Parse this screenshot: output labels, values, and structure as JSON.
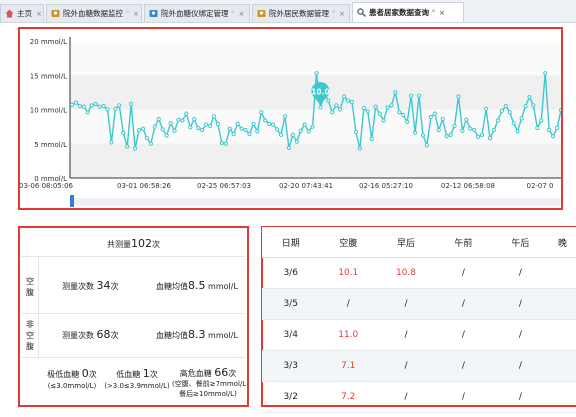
{
  "tabs": [
    {
      "label": "主页",
      "icon": "home-icon",
      "closable": true,
      "refresh": false
    },
    {
      "label": "院外血糖数据监控",
      "icon": "user-edit-icon",
      "closable": true,
      "refresh": true
    },
    {
      "label": "院外血糖仪绑定管理",
      "icon": "monitor-icon",
      "closable": true,
      "refresh": true
    },
    {
      "label": "院外居民数据管理",
      "icon": "user-edit-icon",
      "closable": true,
      "refresh": true
    },
    {
      "label": "患者居家数据查询",
      "icon": "search-icon",
      "closable": true,
      "refresh": true,
      "active": true
    }
  ],
  "tab_refresh_glyph": "ᴳ",
  "tab_close_glyph": "×",
  "chart_data": {
    "type": "line",
    "yticks": [
      "20 mmol/L",
      "15 mmol/L",
      "10 mmol/L",
      "5 mmol/L",
      "0 mmol/L"
    ],
    "ylim": [
      0,
      20
    ],
    "xticks": [
      "03-06 08:05:06",
      "03-01 06:58:26",
      "02-25 06:57:03",
      "02-20 07:43:41",
      "02-16 05:27:10",
      "02-12 06:58:08",
      "02-07 0"
    ],
    "tooltip": "10.0",
    "color": "#3cc8cf",
    "series": [
      {
        "values": [
          10.7,
          11.0,
          10.5,
          10.4,
          9.6,
          10.6,
          10.8,
          10.4,
          10.5,
          10.0,
          5.2,
          10.1,
          10.6,
          6.6,
          4.6,
          10.8,
          4.3,
          7.0,
          7.2,
          5.8,
          5.0,
          7.5,
          8.6,
          7.1,
          6.2,
          8.0,
          6.9,
          8.5,
          8.4,
          9.4,
          7.4,
          8.6,
          7.3,
          7.0,
          7.8,
          7.6,
          9.0,
          7.9,
          5.1,
          5.0,
          7.2,
          6.4,
          7.9,
          7.2,
          7.0,
          6.4,
          7.9,
          6.8,
          9.6,
          8.4,
          7.9,
          7.8,
          7.1,
          6.3,
          9.0,
          4.4,
          6.3,
          5.3,
          6.9,
          7.8,
          6.8,
          7.5,
          15.3,
          10.3,
          12.2,
          11.3,
          9.6,
          10.6,
          10.0,
          11.9,
          11.3,
          11.1,
          6.7,
          4.3,
          10.2,
          9.7,
          5.7,
          10.4,
          9.4,
          8.4,
          10.3,
          10.6,
          12.5,
          9.6,
          9.2,
          8.2,
          12.0,
          6.6,
          12.0,
          6.2,
          4.8,
          8.9,
          9.4,
          7.0,
          8.6,
          6.1,
          6.3,
          7.6,
          11.9,
          6.9,
          8.5,
          7.2,
          7.0,
          6.0,
          6.3,
          10.1,
          5.8,
          7.0,
          8.4,
          9.8,
          10.5,
          9.6,
          8.0,
          6.8,
          8.7,
          10.5,
          11.8,
          10.6,
          7.3,
          8.4,
          15.3,
          7.0,
          6.1,
          7.3,
          9.9
        ]
      }
    ]
  },
  "stats": {
    "total_label": "共测量",
    "total_value": "102",
    "total_unit": "次",
    "fasting_label": "空腹",
    "fasting_count_label": "测量次数",
    "fasting_count": "34",
    "fasting_count_unit": "次",
    "fasting_avg_label": "血糖均值",
    "fasting_avg": "8.5",
    "fasting_avg_unit": "mmol/L",
    "nonfasting_label": "非空腹",
    "nonfasting_count_label": "测量次数",
    "nonfasting_count": "68",
    "nonfasting_count_unit": "次",
    "nonfasting_avg_label": "血糖均值",
    "nonfasting_avg": "8.3",
    "nonfasting_avg_unit": "mmol/L",
    "very_low_label": "极低血糖",
    "very_low": "0",
    "very_low_unit": "次",
    "very_low_range": "(≤3.0mmol/L)",
    "low_label": "低血糖",
    "low": "1",
    "low_unit": "次",
    "low_range": "(>3.0≤3.9mmol/L)",
    "high_label": "高危血糖",
    "high": "66",
    "high_unit": "次",
    "high_range1": "(空腹、餐前≥7mmol/L",
    "high_range2": "餐后≥10mmol/L)"
  },
  "table": {
    "headers": [
      "日期",
      "空腹",
      "早后",
      "午前",
      "午后",
      "晚"
    ],
    "rows": [
      [
        "3/6",
        "10.1",
        "10.8",
        "/",
        "/",
        ""
      ],
      [
        "3/5",
        "/",
        "/",
        "/",
        "/",
        ""
      ],
      [
        "3/4",
        "11.0",
        "/",
        "/",
        "/",
        ""
      ],
      [
        "3/3",
        "7.1",
        "/",
        "/",
        "/",
        ""
      ],
      [
        "3/2",
        "7.2",
        "/",
        "/",
        "/",
        ""
      ]
    ]
  }
}
